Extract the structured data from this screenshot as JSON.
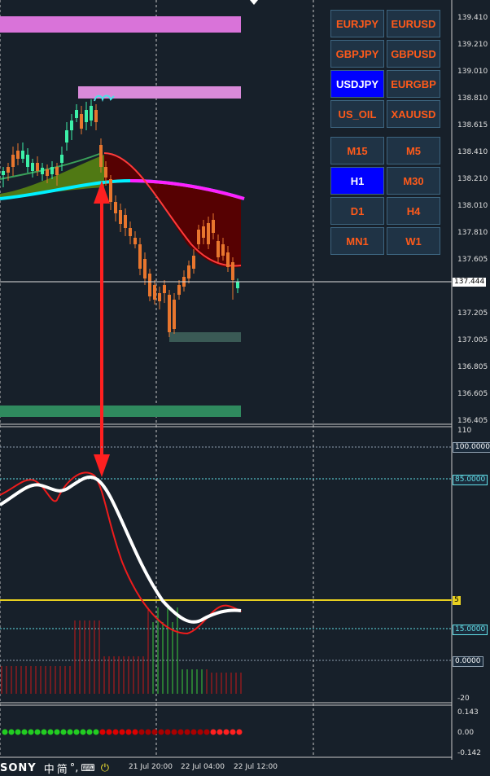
{
  "symbol_buttons": [
    {
      "label": "EURJPY",
      "active": false
    },
    {
      "label": "EURUSD",
      "active": false
    },
    {
      "label": "GBPJPY",
      "active": false
    },
    {
      "label": "GBPUSD",
      "active": false
    },
    {
      "label": "USDJPY",
      "active": true
    },
    {
      "label": "EURGBP",
      "active": false
    },
    {
      "label": "US_OIL",
      "active": false
    },
    {
      "label": "XAUUSD",
      "active": false
    }
  ],
  "timeframe_buttons": [
    {
      "label": "M15",
      "active": false
    },
    {
      "label": "M5",
      "active": false
    },
    {
      "label": "H1",
      "active": true
    },
    {
      "label": "M30",
      "active": false
    },
    {
      "label": "D1",
      "active": false
    },
    {
      "label": "H4",
      "active": false
    },
    {
      "label": "MN1",
      "active": false
    },
    {
      "label": "W1",
      "active": false
    }
  ],
  "price_axis": [
    "139.410",
    "139.210",
    "139.010",
    "138.810",
    "138.615",
    "138.410",
    "138.210",
    "138.010",
    "137.810",
    "137.605",
    "137.205",
    "137.005",
    "136.805",
    "136.605",
    "136.405"
  ],
  "current_price": "137.444",
  "oscillator_axis": {
    "top": "110",
    "bottom": "-20"
  },
  "oscillator_levels": {
    "l100": "100.0000",
    "l85": "85.0000",
    "l5": "5",
    "l15": "15.0000",
    "l0": "0.0000"
  },
  "momentum_axis": {
    "top": "0.143",
    "mid": "0.00",
    "bottom": "-0.142"
  },
  "time_axis": [
    "21 Jul 20:00",
    "22 Jul 04:00",
    "22 Jul 12:00"
  ],
  "taskbar": {
    "brand": "SONY",
    "ime_lang": "中",
    "ime_mode": "简"
  },
  "colors": {
    "background": "#17202a",
    "bull": "#3cf0a8",
    "bear": "#e8762e",
    "active_button": "#0000ff",
    "button_text": "#ff5a1a"
  },
  "chart_data": {
    "type": "candlestick",
    "symbol": "USDJPY",
    "timeframe": "H1",
    "ylim": [
      136.405,
      139.41
    ],
    "last_price": 137.444,
    "oscillator_ylim": [
      -20,
      110
    ],
    "oscillator_levels": [
      100,
      85,
      15,
      5,
      0
    ],
    "momentum_ylim": [
      -0.142,
      0.143
    ],
    "x_ticks": [
      "21 Jul 20:00",
      "22 Jul 04:00",
      "22 Jul 12:00"
    ]
  }
}
